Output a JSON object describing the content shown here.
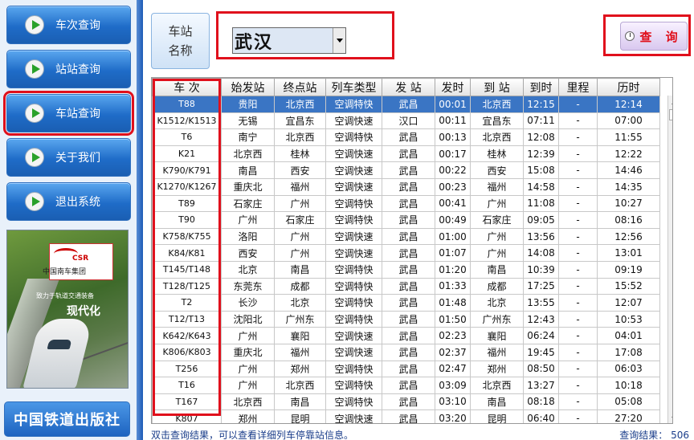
{
  "sidebar": {
    "items": [
      {
        "label": "车次查询",
        "active": false
      },
      {
        "label": "站站查询",
        "active": false
      },
      {
        "label": "车站查询",
        "active": true
      },
      {
        "label": "关于我们",
        "active": false
      },
      {
        "label": "退出系统",
        "active": false
      }
    ],
    "banner": {
      "logo": "CSR",
      "company": "中国南车集团",
      "slogan": "致力于轨道交通装备",
      "slogan2": "现代化"
    },
    "publisher": "中国铁道出版社"
  },
  "search": {
    "station_label_line1": "车站",
    "station_label_line2": "名称",
    "station_value": "武汉",
    "query_button": "查 询"
  },
  "table": {
    "headers": [
      "车  次",
      "始发站",
      "终点站",
      "列车类型",
      "发  站",
      "发时",
      "到  站",
      "到时",
      "里程",
      "历时"
    ],
    "rows": [
      [
        "T88",
        "贵阳",
        "北京西",
        "空调特快",
        "武昌",
        "00:01",
        "北京西",
        "12:15",
        "-",
        "12:14"
      ],
      [
        "K1512/K1513",
        "无锡",
        "宜昌东",
        "空调快速",
        "汉口",
        "00:11",
        "宜昌东",
        "07:11",
        "-",
        "07:00"
      ],
      [
        "T6",
        "南宁",
        "北京西",
        "空调特快",
        "武昌",
        "00:13",
        "北京西",
        "12:08",
        "-",
        "11:55"
      ],
      [
        "K21",
        "北京西",
        "桂林",
        "空调快速",
        "武昌",
        "00:17",
        "桂林",
        "12:39",
        "-",
        "12:22"
      ],
      [
        "K790/K791",
        "南昌",
        "西安",
        "空调快速",
        "武昌",
        "00:22",
        "西安",
        "15:08",
        "-",
        "14:46"
      ],
      [
        "K1270/K1267",
        "重庆北",
        "福州",
        "空调快速",
        "武昌",
        "00:23",
        "福州",
        "14:58",
        "-",
        "14:35"
      ],
      [
        "T89",
        "石家庄",
        "广州",
        "空调特快",
        "武昌",
        "00:41",
        "广州",
        "11:08",
        "-",
        "10:27"
      ],
      [
        "T90",
        "广州",
        "石家庄",
        "空调特快",
        "武昌",
        "00:49",
        "石家庄",
        "09:05",
        "-",
        "08:16"
      ],
      [
        "K758/K755",
        "洛阳",
        "广州",
        "空调快速",
        "武昌",
        "01:00",
        "广州",
        "13:56",
        "-",
        "12:56"
      ],
      [
        "K84/K81",
        "西安",
        "广州",
        "空调快速",
        "武昌",
        "01:07",
        "广州",
        "14:08",
        "-",
        "13:01"
      ],
      [
        "T145/T148",
        "北京",
        "南昌",
        "空调特快",
        "武昌",
        "01:20",
        "南昌",
        "10:39",
        "-",
        "09:19"
      ],
      [
        "T128/T125",
        "东莞东",
        "成都",
        "空调特快",
        "武昌",
        "01:33",
        "成都",
        "17:25",
        "-",
        "15:52"
      ],
      [
        "T2",
        "长沙",
        "北京",
        "空调特快",
        "武昌",
        "01:48",
        "北京",
        "13:55",
        "-",
        "12:07"
      ],
      [
        "T12/T13",
        "沈阳北",
        "广州东",
        "空调特快",
        "武昌",
        "01:50",
        "广州东",
        "12:43",
        "-",
        "10:53"
      ],
      [
        "K642/K643",
        "广州",
        "襄阳",
        "空调快速",
        "武昌",
        "02:23",
        "襄阳",
        "06:24",
        "-",
        "04:01"
      ],
      [
        "K806/K803",
        "重庆北",
        "福州",
        "空调快速",
        "武昌",
        "02:37",
        "福州",
        "19:45",
        "-",
        "17:08"
      ],
      [
        "T256",
        "广州",
        "郑州",
        "空调特快",
        "武昌",
        "02:47",
        "郑州",
        "08:50",
        "-",
        "06:03"
      ],
      [
        "T16",
        "广州",
        "北京西",
        "空调特快",
        "武昌",
        "03:09",
        "北京西",
        "13:27",
        "-",
        "10:18"
      ],
      [
        "T167",
        "北京西",
        "南昌",
        "空调特快",
        "武昌",
        "03:10",
        "南昌",
        "08:18",
        "-",
        "05:08"
      ],
      [
        "K807",
        "郑州",
        "昆明",
        "空调快速",
        "武昌",
        "03:20",
        "昆明",
        "06:40",
        "-",
        "27:20"
      ]
    ]
  },
  "status": {
    "hint": "双击查询结果，可以查看详细列车停靠站信息。",
    "result_label": "查询结果：",
    "result_count": "506"
  },
  "colors": {
    "accent": "#1f6cc8",
    "highlight": "#e0101c",
    "selected_row": "#3a75c4"
  }
}
